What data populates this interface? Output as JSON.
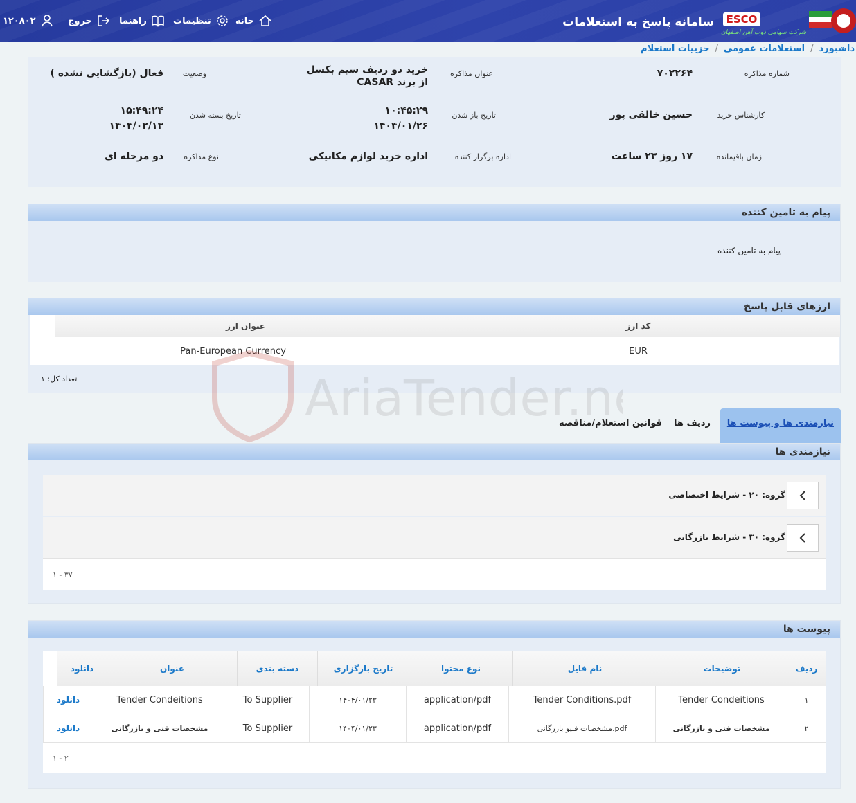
{
  "header": {
    "title": "سامانه پاسخ به استعلامات",
    "brand": "ESCO",
    "brand_sub": "شرکت سهامی ذوب آهن اصفهان",
    "user_id": "۱۲۰۸۰۲",
    "logout": "خروج",
    "guide": "راهنما",
    "settings": "تنظیمات",
    "home": "خانه"
  },
  "breadcrumb": [
    "داشبورد",
    "استعلامات عمومی",
    "جزییات استعلام"
  ],
  "info": {
    "number_label": "شماره مذاکره",
    "number": "۷۰۲۲۶۴",
    "subject_label": "عنوان مذاکره",
    "subject": "خرید دو ردیف سیم بکسل از برند CASAR",
    "status_label": "وضعیت",
    "status": "فعال (بازگشایی نشده )",
    "buyer_label": "کارشناس خرید",
    "buyer": "حسین خالقی پور",
    "open_label": "تاریخ باز شدن",
    "open_time": "۱۰:۴۵:۲۹",
    "open_date": "۱۴۰۴/۰۱/۲۶",
    "close_label": "تاریخ بسته شدن",
    "close_time": "۱۵:۴۹:۲۴",
    "close_date": "۱۴۰۴/۰۲/۱۳",
    "remaining_label": "زمان باقیمانده",
    "remaining": "۱۷ روز ۲۳ ساعت",
    "organizer_label": "اداره برگزار کننده",
    "organizer": "اداره خرید لوازم مکانیکی",
    "type_label": "نوع مذاکره",
    "type": "دو مرحله ای"
  },
  "message": {
    "title": "پیام به تامین کننده",
    "label": "پیام به تامین کننده"
  },
  "currency": {
    "title": "ارزهای قابل پاسخ",
    "headers": [
      "کد ارز",
      "عنوان ارز"
    ],
    "rows": [
      [
        "EUR",
        "Pan-European Currency"
      ]
    ],
    "total": "تعداد کل: ۱"
  },
  "tabs": [
    "نیازمندی ها و پیوست ها",
    "ردیف ها",
    "قوانین استعلام/مناقصه"
  ],
  "requirements": {
    "title": "نیازمندی ها",
    "groups": [
      "گروه: ۲۰ - شرایط اختصاصی",
      "گروه: ۳۰ - شرایط بازرگانی"
    ],
    "pager": "۱ - ۳۷"
  },
  "attachments": {
    "title": "پیوست ها",
    "headers": [
      "ردیف",
      "توضیحات",
      "نام فایل",
      "نوع محتوا",
      "تاریخ بارگزاری",
      "دسته بندی",
      "عنوان",
      "دانلود"
    ],
    "rows": [
      [
        "۱",
        "Tender Condeitions",
        "Tender Conditions.pdf",
        "application/pdf",
        "۱۴۰۴/۰۱/۲۳",
        "To Supplier",
        "Tender Condeitions",
        "دانلود"
      ],
      [
        "۲",
        "مشخصات فنی و بازرگانی",
        "مشخصات فنیو بازرگانی.pdf",
        "application/pdf",
        "۱۴۰۴/۰۱/۲۳",
        "To Supplier",
        "مشخصات فنی و بازرگانی",
        "دانلود"
      ]
    ],
    "pager": "۱ - ۲"
  },
  "watermark": "AriaTender.neT"
}
